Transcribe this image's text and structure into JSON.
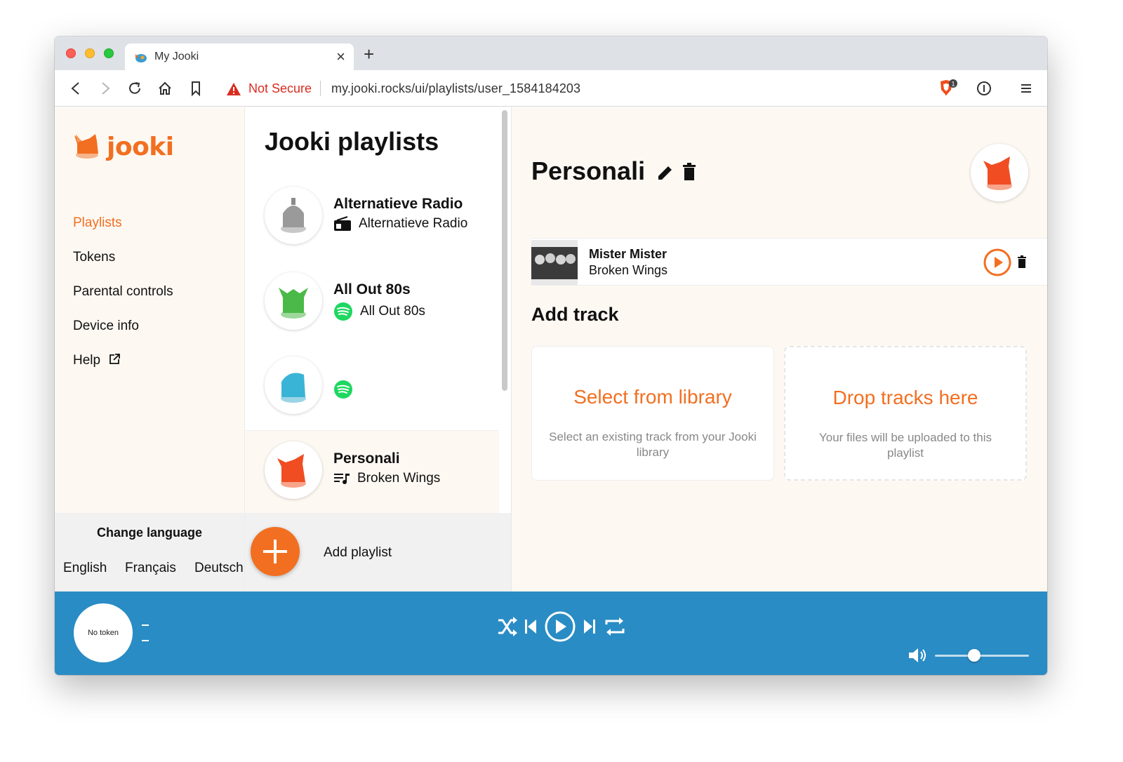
{
  "browser": {
    "tab_title": "My Jooki",
    "security_label": "Not Secure",
    "url": "my.jooki.rocks/ui/playlists/user_1584184203",
    "brave_badge_count": "1"
  },
  "sidebar": {
    "logo_text": "jooki",
    "nav": [
      "Playlists",
      "Tokens",
      "Parental controls",
      "Device info",
      "Help"
    ],
    "active": "Playlists",
    "language_title": "Change language",
    "languages": [
      "English",
      "Français",
      "Deutsch"
    ]
  },
  "playlists": {
    "title": "Jooki playlists",
    "items": [
      {
        "name": "Alternatieve Radio",
        "subtitle": "Alternatieve Radio",
        "source": "radio-icon",
        "figure_color": "#9a9a9a"
      },
      {
        "name": "All Out 80s",
        "subtitle": "All Out 80s",
        "source": "spotify-icon",
        "figure_color": "#4ab948"
      },
      {
        "name": "",
        "subtitle": "",
        "source": "spotify-icon",
        "figure_color": "#3ab4d6"
      },
      {
        "name": "Personali",
        "subtitle": "Broken Wings",
        "source": "playlist-icon",
        "figure_color": "#f04d23"
      }
    ],
    "add_label": "Add playlist"
  },
  "detail": {
    "playlist_name": "Personali",
    "tracks": [
      {
        "artist": "Mister Mister",
        "title": "Broken Wings"
      }
    ],
    "add_track_title": "Add track",
    "library_card": {
      "title": "Select from library",
      "description": "Select an existing track from your Jooki library"
    },
    "drop_card": {
      "title": "Drop tracks here",
      "description": "Your files will be uploaded to this playlist"
    }
  },
  "player": {
    "token_label": "No token",
    "volume_level": 0.42
  },
  "colors": {
    "accent": "#f26f21",
    "player_bg": "#2a8cc4",
    "sidebar_bg": "#fdf8f2",
    "spotify": "#1ed760"
  }
}
